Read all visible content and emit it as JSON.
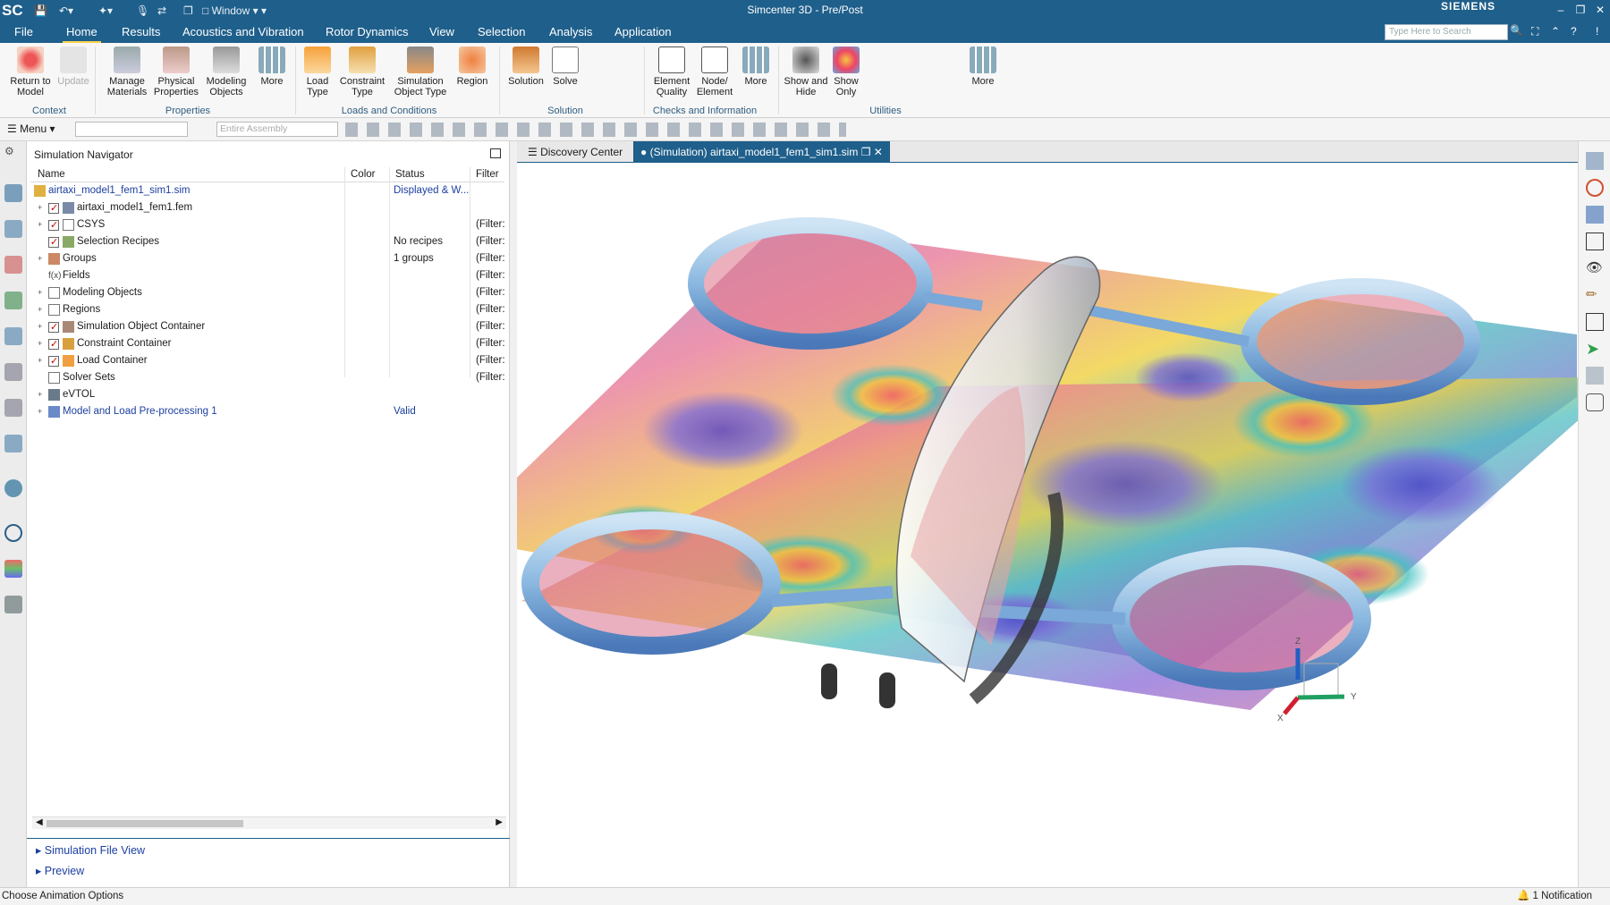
{
  "app": {
    "logo": "SC",
    "title": "Simcenter 3D - Pre/Post",
    "brand": "SIEMENS",
    "window_menu": "Window",
    "search_placeholder": "Type Here to Search"
  },
  "menu_tabs": [
    "File",
    "Home",
    "Results",
    "Acoustics and Vibration",
    "Rotor Dynamics",
    "View",
    "Selection",
    "Analysis",
    "Application"
  ],
  "active_tab": "Home",
  "ribbon": {
    "context": {
      "label": "Context",
      "buttons": [
        "Return to Model",
        "Update"
      ]
    },
    "properties": {
      "label": "Properties",
      "buttons": [
        "Manage Materials",
        "Physical Properties",
        "Modeling Objects",
        "More"
      ]
    },
    "loads": {
      "label": "Loads and Conditions",
      "buttons": [
        "Load Type",
        "Constraint Type",
        "Simulation Object Type",
        "Region"
      ]
    },
    "solution": {
      "label": "Solution",
      "buttons": [
        "Solution",
        "Solve"
      ]
    },
    "checks": {
      "label": "Checks and Information",
      "buttons": [
        "Element Quality",
        "Node/ Element",
        "More"
      ]
    },
    "utilities": {
      "label": "Utilities",
      "buttons": [
        "Show and Hide",
        "Show Only",
        "More"
      ]
    }
  },
  "toolbar2": {
    "menu_label": "Menu",
    "assembly_filter": "Entire Assembly"
  },
  "navigator": {
    "title": "Simulation Navigator",
    "columns": [
      "Name",
      "Color",
      "Status",
      "Filter"
    ],
    "rows": [
      {
        "name": "airtaxi_model1_fem1_sim1.sim",
        "status": "Displayed & W...",
        "filter": ""
      },
      {
        "name": "airtaxi_model1_fem1.fem",
        "status": "",
        "filter": ""
      },
      {
        "name": "CSYS",
        "status": "",
        "filter": "(Filter:"
      },
      {
        "name": "Selection Recipes",
        "status": "No recipes",
        "filter": "(Filter:"
      },
      {
        "name": "Groups",
        "status": "1 groups",
        "filter": "(Filter:"
      },
      {
        "name": "Fields",
        "status": "",
        "filter": "(Filter:"
      },
      {
        "name": "Modeling Objects",
        "status": "",
        "filter": "(Filter:"
      },
      {
        "name": "Regions",
        "status": "",
        "filter": "(Filter:"
      },
      {
        "name": "Simulation Object Container",
        "status": "",
        "filter": "(Filter:"
      },
      {
        "name": "Constraint Container",
        "status": "",
        "filter": "(Filter:"
      },
      {
        "name": "Load Container",
        "status": "",
        "filter": "(Filter:"
      },
      {
        "name": "Solver Sets",
        "status": "",
        "filter": "(Filter:"
      },
      {
        "name": "eVTOL",
        "status": "",
        "filter": ""
      },
      {
        "name": "Model and Load Pre-processing 1",
        "status": "Valid",
        "filter": ""
      }
    ],
    "sections": [
      "Simulation File View",
      "Preview"
    ]
  },
  "view_tabs": [
    "Discovery Center",
    "(Simulation) airtaxi_model1_fem1_sim1.sim"
  ],
  "triad": {
    "x": "X",
    "y": "Y",
    "z": "Z"
  },
  "status": {
    "left": "Choose Animation Options",
    "right": "1 Notification"
  },
  "colors": {
    "chrome": "#1f5f8b",
    "accent": "#ffd24a",
    "link": "#1c3fa0"
  }
}
